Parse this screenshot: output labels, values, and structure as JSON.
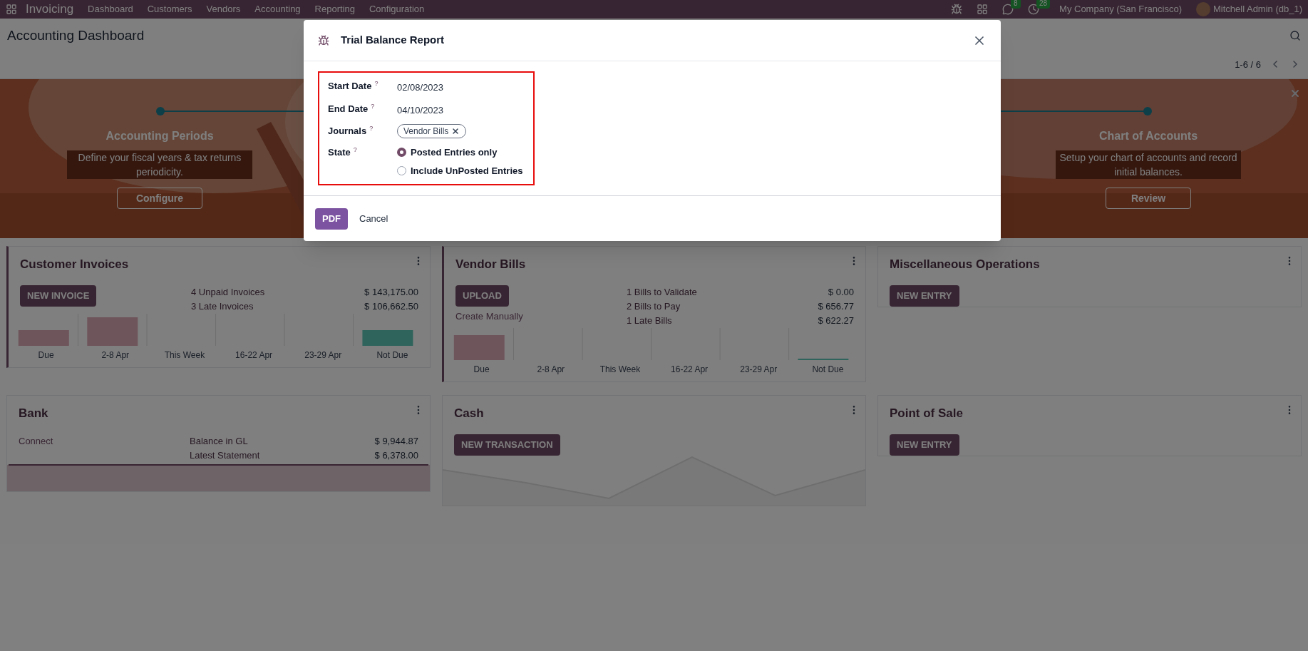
{
  "topbar": {
    "app": "Invoicing",
    "menu": [
      "Dashboard",
      "Customers",
      "Vendors",
      "Accounting",
      "Reporting",
      "Configuration"
    ],
    "badges": [
      {
        "kind": "chat",
        "count": "8"
      },
      {
        "kind": "activity",
        "count": "28"
      }
    ],
    "company": "My Company (San Francisco)",
    "user": "Mitchell Admin (db_1)"
  },
  "control_panel": {
    "title": "Accounting Dashboard",
    "pager": "1-6 / 6"
  },
  "banner": {
    "steps": [
      {
        "title": "Accounting Periods",
        "text": "Define your fiscal years & tax returns periodicity.",
        "button": "Configure"
      },
      {
        "title": "Chart of Accounts",
        "text": "Setup your chart of accounts and record initial balances.",
        "button": "Review"
      }
    ]
  },
  "cards": [
    {
      "kind": "sales",
      "title": "Customer Invoices",
      "accent": true,
      "button": "NEW INVOICE",
      "rows": [
        {
          "label": "4 Unpaid Invoices",
          "value": "$ 143,175.00"
        },
        {
          "label": "3 Late Invoices",
          "value": "$ 106,662.50"
        }
      ],
      "categories": [
        "Due",
        "2-8 Apr",
        "This Week",
        "16-22 Apr",
        "23-29 Apr",
        "Not Due"
      ]
    },
    {
      "kind": "purchase",
      "title": "Vendor Bills",
      "accent": true,
      "button": "UPLOAD",
      "links": [
        "Create Manually"
      ],
      "rows": [
        {
          "label": "1 Bills to Validate",
          "value": "$ 0.00"
        },
        {
          "label": "2 Bills to Pay",
          "value": "$ 656.77"
        },
        {
          "label": "1 Late Bills",
          "value": "$ 622.27"
        }
      ],
      "categories": [
        "Due",
        "2-8 Apr",
        "This Week",
        "16-22 Apr",
        "23-29 Apr",
        "Not Due"
      ]
    },
    {
      "kind": "general",
      "title": "Miscellaneous Operations",
      "accent": false,
      "button": "NEW ENTRY"
    },
    {
      "kind": "bank",
      "title": "Bank",
      "accent": false,
      "links": [
        "Connect"
      ],
      "rows": [
        {
          "label": "Balance in GL",
          "value": "$ 9,944.87"
        },
        {
          "label": "Latest Statement",
          "value": "$ 6,378.00"
        }
      ]
    },
    {
      "kind": "cash",
      "title": "Cash",
      "accent": false,
      "button": "NEW TRANSACTION"
    },
    {
      "kind": "general",
      "title": "Point of Sale",
      "accent": false,
      "button": "NEW ENTRY"
    }
  ],
  "dialog": {
    "title": "Trial Balance Report",
    "fields": [
      {
        "kind": "text",
        "label": "Start Date",
        "value": "02/08/2023"
      },
      {
        "kind": "text",
        "label": "End Date",
        "value": "04/10/2023"
      },
      {
        "kind": "tags",
        "label": "Journals",
        "tags": [
          "Vendor Bills"
        ]
      },
      {
        "kind": "radio",
        "label": "State",
        "options": [
          {
            "label": "Posted Entries only",
            "selected": true
          },
          {
            "label": "Include UnPosted Entries",
            "selected": false
          }
        ]
      }
    ],
    "help_mark": "?",
    "buttons": [
      {
        "kind": "primary",
        "label": "PDF"
      },
      {
        "kind": "link",
        "label": "Cancel"
      }
    ]
  }
}
